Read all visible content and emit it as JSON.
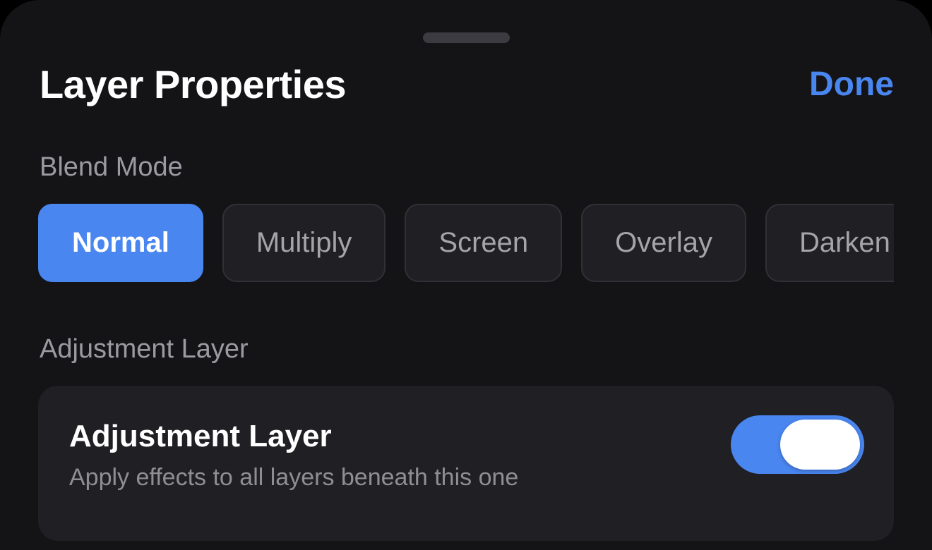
{
  "sheet": {
    "title": "Layer Properties",
    "done_label": "Done"
  },
  "blend_mode": {
    "label": "Blend Mode",
    "options": [
      "Normal",
      "Multiply",
      "Screen",
      "Overlay",
      "Darken"
    ],
    "selected": "Normal"
  },
  "adjustment": {
    "section_label": "Adjustment Layer",
    "row_title": "Adjustment Layer",
    "row_subtitle": "Apply effects to all layers beneath this one",
    "enabled": true
  },
  "colors": {
    "accent": "#4a86f0",
    "background": "#141417",
    "card": "#1f1f24"
  }
}
